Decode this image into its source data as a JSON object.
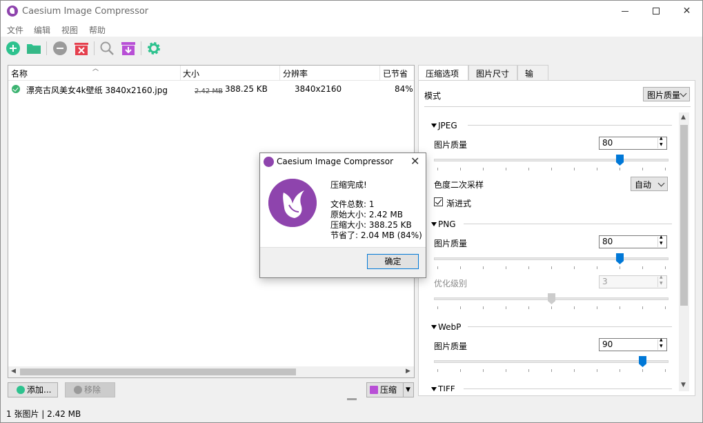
{
  "window": {
    "title": "Caesium Image Compressor"
  },
  "menu": [
    "文件",
    "编辑",
    "视图",
    "帮助"
  ],
  "toolbar": {
    "icons": [
      "add-icon",
      "folder-icon",
      "remove-icon",
      "clear-icon",
      "preview-icon",
      "export-icon",
      "settings-icon"
    ],
    "colors": {
      "green": "#2dc28e",
      "purple": "#b84fd6",
      "red": "#e5404e",
      "gray": "#9a9a9a"
    }
  },
  "file_list": {
    "columns": [
      "名称",
      "大小",
      "分辨率",
      "已节省"
    ],
    "rows": [
      {
        "name": "漂亮古风美女4k壁纸 3840x2160.jpg",
        "original_size": "2.42 MB",
        "new_size": "388.25 KB",
        "resolution": "3840x2160",
        "saved": "84%"
      }
    ]
  },
  "buttons": {
    "add": "添加...",
    "remove": "移除",
    "compress": "压缩"
  },
  "status": {
    "text": "1 张图片 | 2.42 MB"
  },
  "tabs": [
    "压缩选项",
    "图片尺寸",
    "输出"
  ],
  "options": {
    "mode_label": "模式",
    "mode_value": "图片质量",
    "jpeg": {
      "section": "JPEG",
      "quality_label": "图片质量",
      "quality_value": "80",
      "quality_level": 0.8,
      "chroma_label": "色度二次采样",
      "chroma_value": "自动",
      "progressive_label": "渐进式",
      "progressive_checked": true
    },
    "png": {
      "section": "PNG",
      "quality_label": "图片质量",
      "quality_value": "80",
      "quality_level": 0.8,
      "optimization_label": "优化级别",
      "optimization_value": "3",
      "optimization_level": 0.5
    },
    "webp": {
      "section": "WebP",
      "quality_label": "图片质量",
      "quality_value": "90",
      "quality_level": 0.9
    },
    "tiff": {
      "section": "TIFF"
    }
  },
  "dialog": {
    "title": "Caesium Image Compressor",
    "heading": "压缩完成!",
    "total_files": "文件总数: 1",
    "original_size": "原始大小: 2.42 MB",
    "compressed_size": "压缩大小: 388.25 KB",
    "saved": "节省了: 2.04 MB (84%)",
    "ok": "确定"
  }
}
